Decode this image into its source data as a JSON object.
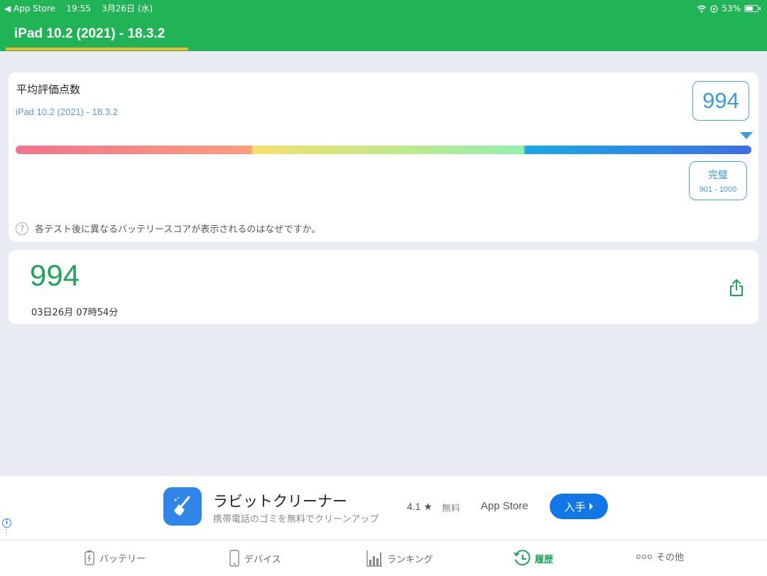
{
  "status_bar": {
    "back_app": "App Store",
    "time": "19:55",
    "date": "3月26日 (水)",
    "battery_percent": "53%",
    "battery_level": 0.53
  },
  "header": {
    "tab_title": "iPad 10.2 (2021) - 18.3.2",
    "bg_color": "#21b456",
    "underline_color": "#f2b92c"
  },
  "average_card": {
    "title": "平均評価点数",
    "device": "iPad 10.2 (2021) - 18.3.2",
    "score": "994",
    "rating": {
      "label": "完璧",
      "range": "901 - 1000"
    },
    "help_text": "各テスト後に異なるバッテリースコアが表示されるのはなぜですか。"
  },
  "result_card": {
    "score": "994",
    "datetime": "03日26月 07時54分"
  },
  "ad": {
    "app_name": "ラビットクリーナー",
    "description": "携帯電話のゴミを無料でクリーンアップ",
    "rating": "4.1 ★",
    "price": "無料",
    "store": "App Store",
    "button": "入手"
  },
  "tab_bar": {
    "items": [
      {
        "label": "バッテリー",
        "icon": "battery-icon"
      },
      {
        "label": "デバイス",
        "icon": "device-icon"
      },
      {
        "label": "ランキング",
        "icon": "ranking-chart-icon"
      },
      {
        "label": "履歴",
        "icon": "history-icon",
        "active": true
      },
      {
        "label": "その他",
        "icon": "more-icon"
      }
    ]
  }
}
